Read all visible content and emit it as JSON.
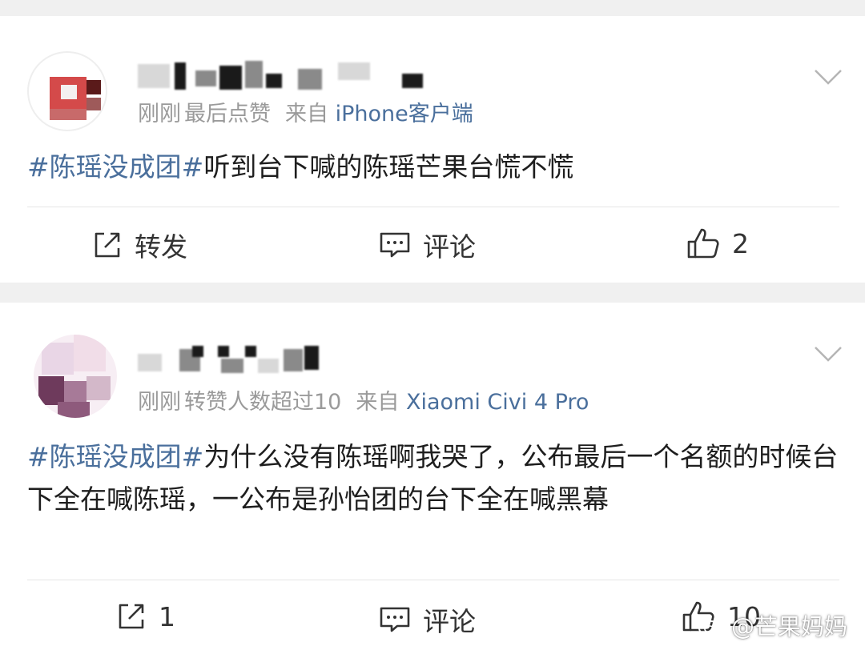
{
  "posts": [
    {
      "meta_time": "刚刚",
      "meta_extra": "最后点赞",
      "meta_from": "来自",
      "meta_source": "iPhone客户端",
      "hashtag": "#陈瑶没成团#",
      "body": "听到台下喊的陈瑶芒果台慌不慌",
      "actions": {
        "repost_label": "转发",
        "comment_label": "评论",
        "like_count": "2"
      }
    },
    {
      "meta_time": "刚刚",
      "meta_extra": "转赞人数超过10",
      "meta_from": "来自",
      "meta_source": "Xiaomi Civi 4 Pro",
      "hashtag": "#陈瑶没成团#",
      "body": "为什么没有陈瑶啊我哭了，公布最后一个名额的时候台下全在喊陈瑶，一公布是孙怡团的台下全在喊黑幕",
      "actions": {
        "repost_label": "1",
        "comment_label": "评论",
        "like_count": "10"
      }
    }
  ],
  "watermark": "@芒果妈妈",
  "colors": {
    "link": "#4a6f9c",
    "meta": "#9a9a9a",
    "text": "#1e1e1e",
    "bg": "#f0f0f0"
  },
  "icons": [
    "chevron-down-icon",
    "repost-icon",
    "comment-icon",
    "like-icon",
    "weibo-logo-icon"
  ]
}
